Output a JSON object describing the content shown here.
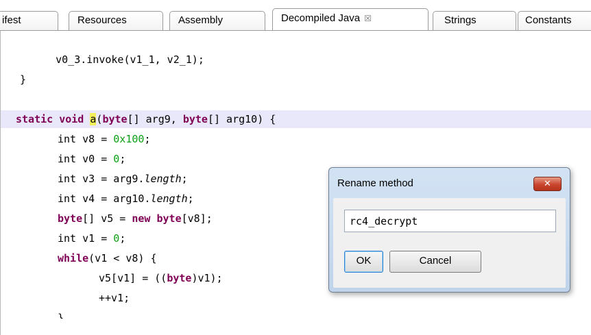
{
  "tabs": [
    {
      "label": "ifest"
    },
    {
      "label": "Resources"
    },
    {
      "label": "Assembly"
    },
    {
      "label": "Decompiled Java",
      "active": true,
      "close_glyph": "☒"
    },
    {
      "label": "Strings"
    },
    {
      "label": "Constants"
    }
  ],
  "code": {
    "line0": "    v0_3.invoke(v1_1, v2_1);",
    "line1": "}",
    "sig_kw1": "static",
    "sig_kw2": "void",
    "sig_name": "a",
    "sig_p1": "(",
    "sig_kw3": "byte",
    "sig_p2": "[] arg9, ",
    "sig_kw4": "byte",
    "sig_p3": "[] arg10) {",
    "l4_a": "int v8 = ",
    "l4_num": "0x100",
    "l4_b": ";",
    "l5_a": "int v0 = ",
    "l5_num": "0",
    "l5_b": ";",
    "l6_a": "int v3 = arg9.",
    "l6_it": "length",
    "l6_b": ";",
    "l7_a": "int v4 = arg10.",
    "l7_it": "length",
    "l7_b": ";",
    "l8_kw": "byte",
    "l8_a": "[] v5 = ",
    "l8_kw2": "new",
    "l8_kw3": "byte",
    "l8_b": "[v8];",
    "l9_a": "int v1 = ",
    "l9_num": "0",
    "l9_b": ";",
    "l10_kw": "while",
    "l10_a": "(v1 < v8) {",
    "l11_a": "v5[v1] = ((",
    "l11_kw": "byte",
    "l11_b": ")v1);",
    "l12_a": "++v1;",
    "l13_a": "}"
  },
  "dialog": {
    "title": "Rename method",
    "close_glyph": "✕",
    "input_value": "rc4_decrypt",
    "ok_label": "OK",
    "cancel_label": "Cancel"
  },
  "colors": {
    "keyword": "#7f0055",
    "number": "#09a013",
    "highlight_line": "#e8e8fa",
    "selection_mark": "#f5f05a"
  }
}
